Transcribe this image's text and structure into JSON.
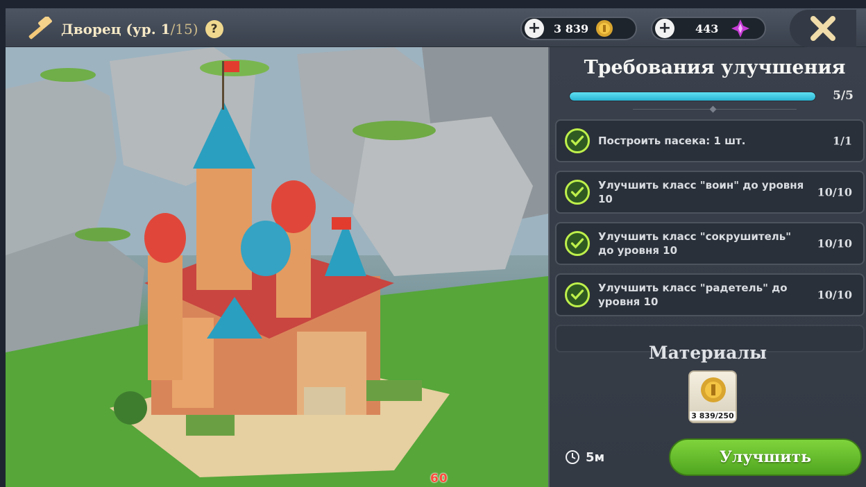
{
  "header": {
    "title": "Дворец (ур. 1",
    "level_suffix": "/15)",
    "help_label": "?"
  },
  "resources": {
    "coins": {
      "value": "3 839",
      "icon": "gold-coin-icon"
    },
    "gems": {
      "value": "443",
      "icon": "purple-gem-icon"
    }
  },
  "panel": {
    "title": "Требования улучшения",
    "progress": {
      "value": 5,
      "max": 5,
      "label": "5/5"
    },
    "requirements": [
      {
        "text": "Построить пасека: 1 шт.",
        "count": "1/1",
        "done": true
      },
      {
        "text": "Улучшить класс \"воин\" до уровня 10",
        "count": "10/10",
        "done": true
      },
      {
        "text": "Улучшить класс \"сокрушитель\" до уровня 10",
        "count": "10/10",
        "done": true
      },
      {
        "text": "Улучшить класс \"радетель\" до уровня 10",
        "count": "10/10",
        "done": true
      }
    ],
    "materials_title": "Материалы",
    "material": {
      "icon": "gold-coin-icon",
      "count": "3 839/250"
    },
    "timer": "5м",
    "upgrade_label": "Улучшить"
  },
  "overlay": {
    "fps": "60"
  },
  "colors": {
    "accent_green": "#5fb52a",
    "progress_cyan": "#2ab5d3",
    "check_green": "#bef04b"
  }
}
